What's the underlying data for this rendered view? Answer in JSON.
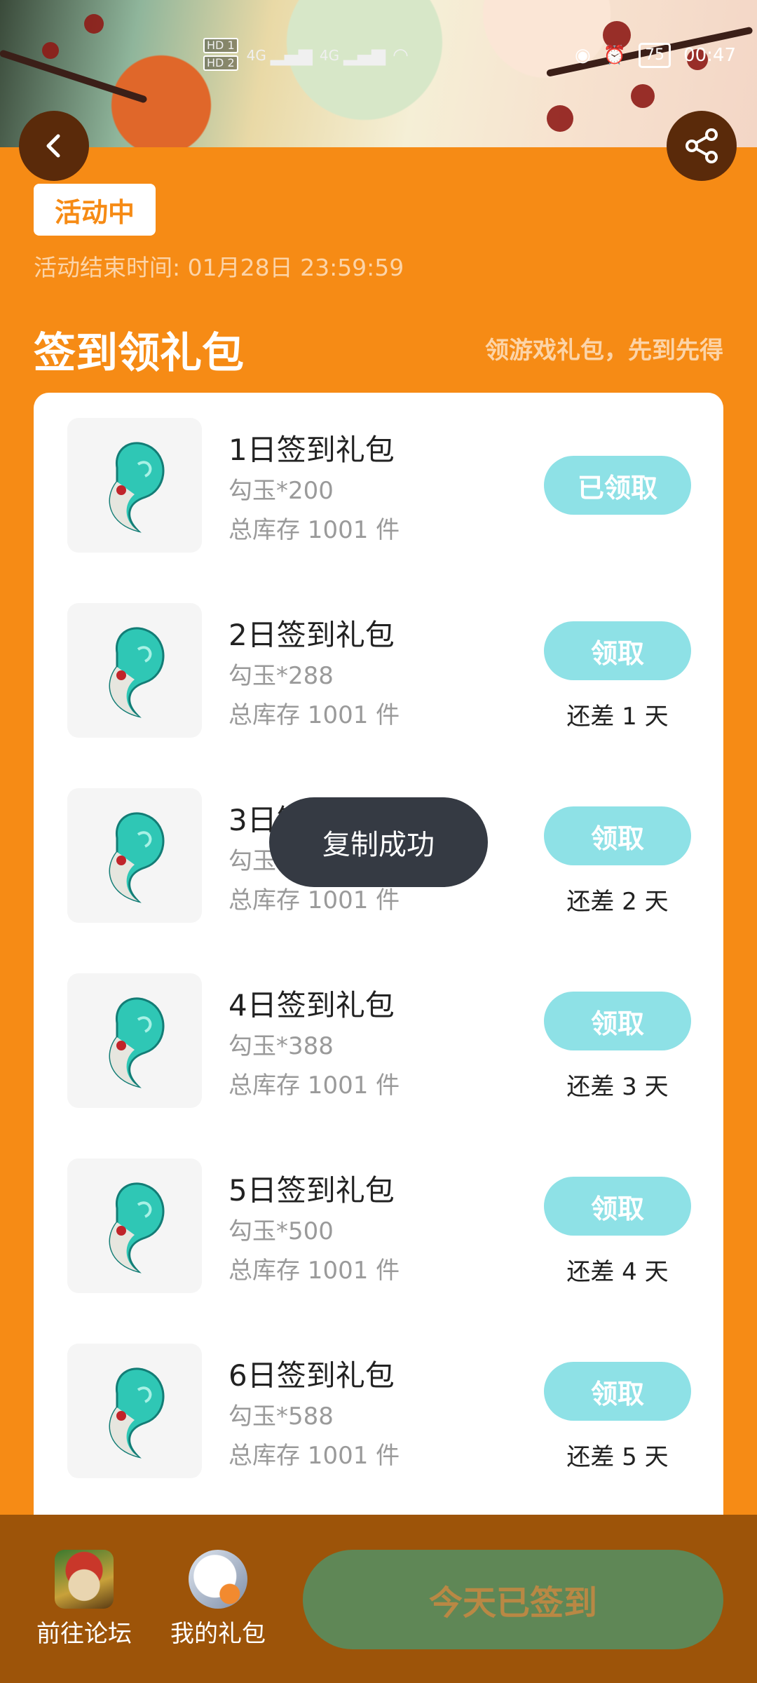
{
  "status_bar": {
    "sim1": "HD 1",
    "sim2": "HD 2",
    "net1": "4G",
    "net2": "4G",
    "battery": "75",
    "time": "00:47"
  },
  "header": {
    "back_icon": "chevron-left-icon",
    "share_icon": "share-icon"
  },
  "activity": {
    "status": "活动中",
    "end_time": "活动结束时间: 01月28日 23:59:59"
  },
  "section": {
    "title": "签到领礼包",
    "subtitle": "领游戏礼包，先到先得"
  },
  "items": [
    {
      "title": "1日签到礼包",
      "reward": "勾玉*200",
      "stock": "总库存 1001 件",
      "button": "已领取",
      "remain": ""
    },
    {
      "title": "2日签到礼包",
      "reward": "勾玉*288",
      "stock": "总库存 1001 件",
      "button": "领取",
      "remain": "还差 1 天"
    },
    {
      "title": "3日签到礼包",
      "reward": "勾玉*300",
      "stock": "总库存 1001 件",
      "button": "领取",
      "remain": "还差 2 天"
    },
    {
      "title": "4日签到礼包",
      "reward": "勾玉*388",
      "stock": "总库存 1001 件",
      "button": "领取",
      "remain": "还差 3 天"
    },
    {
      "title": "5日签到礼包",
      "reward": "勾玉*500",
      "stock": "总库存 1001 件",
      "button": "领取",
      "remain": "还差 4 天"
    },
    {
      "title": "6日签到礼包",
      "reward": "勾玉*588",
      "stock": "总库存 1001 件",
      "button": "领取",
      "remain": "还差 5 天"
    }
  ],
  "toast": "复制成功",
  "bottom": {
    "forum_label": "前往论坛",
    "gift_label": "我的礼包",
    "signed_label": "今天已签到"
  },
  "colors": {
    "background": "#F68B15",
    "claim_button": "#8ee1e6",
    "bottom_bar": "#9d5409",
    "signed_button": "#5f8756"
  }
}
